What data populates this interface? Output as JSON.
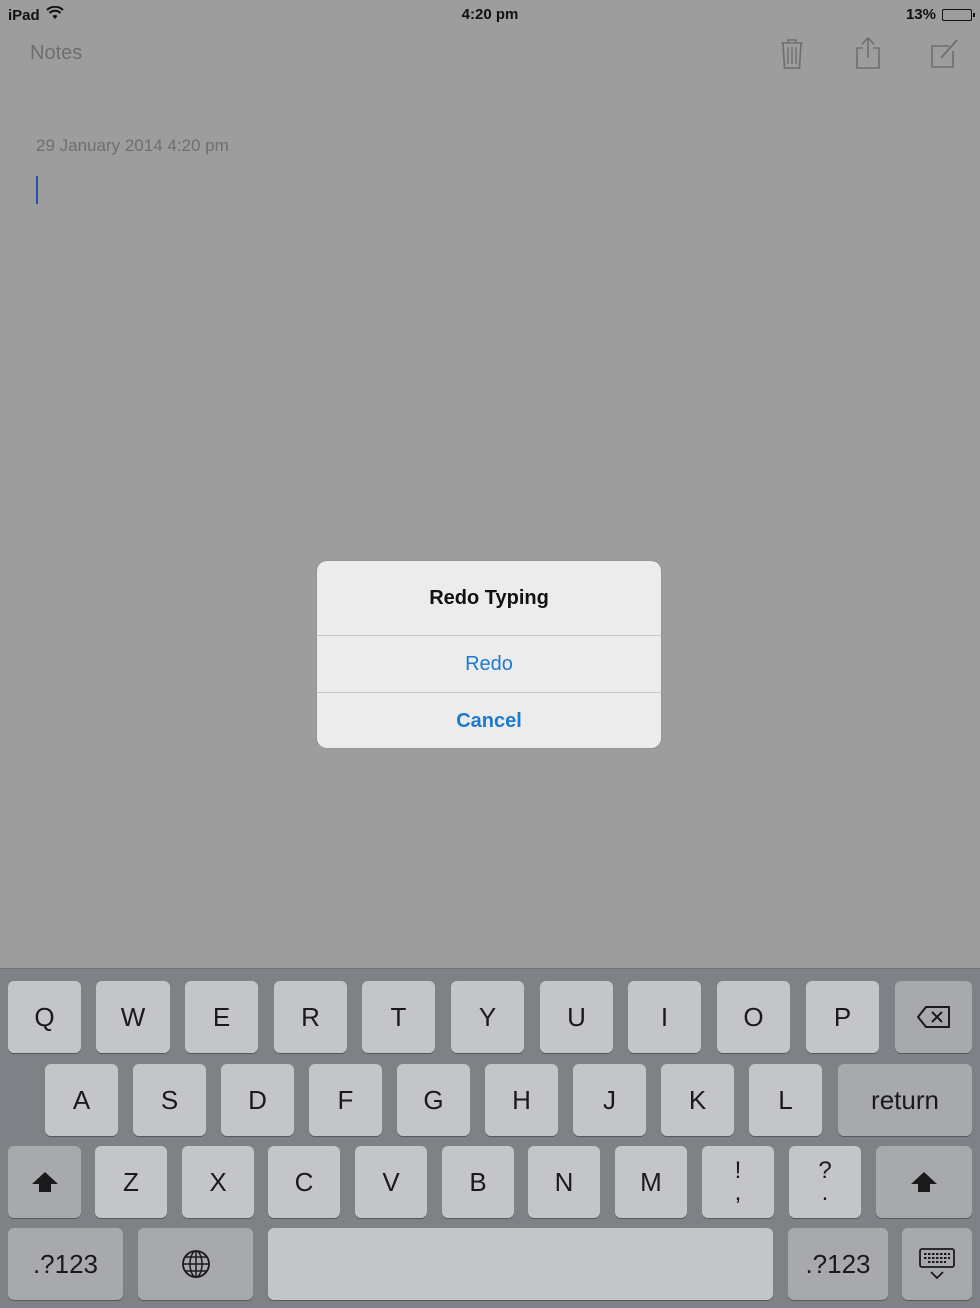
{
  "status_bar": {
    "device": "iPad",
    "time": "4:20 pm",
    "battery_percent": "13%",
    "battery_level": 0.13,
    "wifi_icon": "wifi-icon",
    "battery_icon": "battery-icon"
  },
  "nav": {
    "back_label": "Notes",
    "icons": [
      "trash-icon",
      "share-icon",
      "compose-icon"
    ]
  },
  "note": {
    "date": "29 January 2014 4:20 pm"
  },
  "alert": {
    "title": "Redo Typing",
    "redo_label": "Redo",
    "cancel_label": "Cancel",
    "button_color": "#1d7ad0"
  },
  "keyboard": {
    "row1": [
      "Q",
      "W",
      "E",
      "R",
      "T",
      "Y",
      "U",
      "I",
      "O",
      "P"
    ],
    "row2": [
      "A",
      "S",
      "D",
      "F",
      "G",
      "H",
      "J",
      "K",
      "L"
    ],
    "return_label": "return",
    "row3": [
      "Z",
      "X",
      "C",
      "V",
      "B",
      "N",
      "M"
    ],
    "punct1": [
      "!",
      ","
    ],
    "punct2": [
      "?",
      "."
    ],
    "numbers_label": ".?123",
    "icons": [
      "delete-icon",
      "shift-icon",
      "globe-icon",
      "keyboard-dismiss-icon"
    ]
  }
}
